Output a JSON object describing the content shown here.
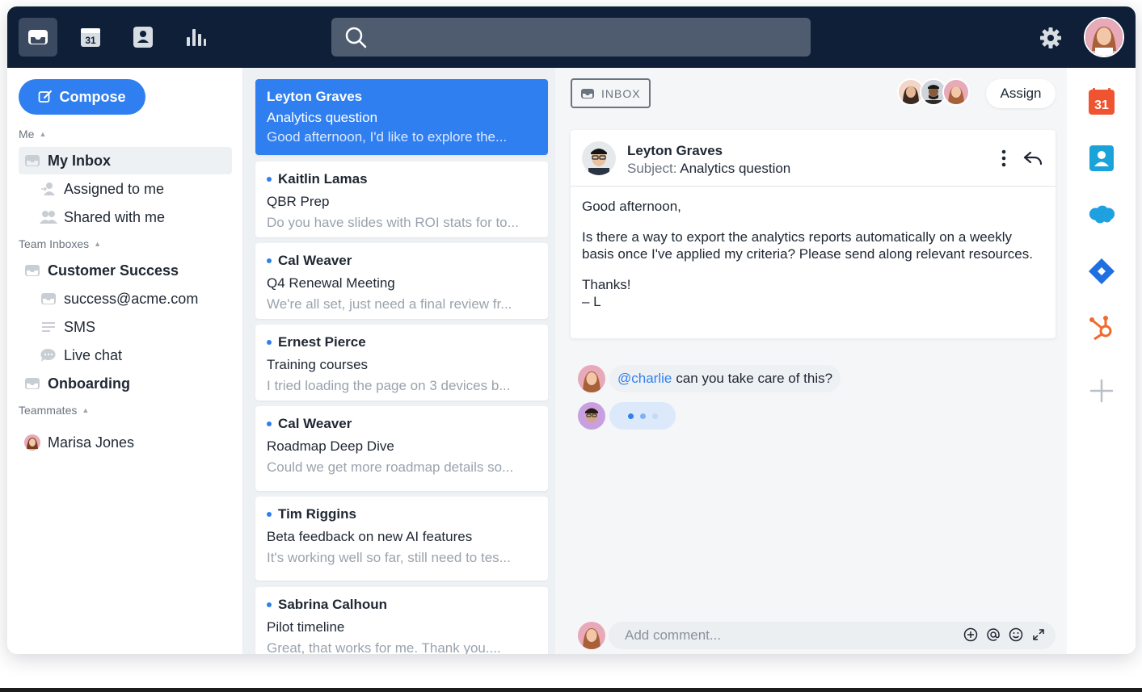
{
  "topbar": {
    "nav_icons": [
      "inbox-icon",
      "calendar-icon",
      "contacts-icon",
      "analytics-icon"
    ],
    "calendar_day": "31",
    "search_placeholder": ""
  },
  "sidebar": {
    "compose_label": "Compose",
    "me_section": "Me",
    "me_items": [
      {
        "label": "My Inbox",
        "icon": "inbox-icon"
      },
      {
        "label": "Assigned to me",
        "icon": "assigned-icon"
      },
      {
        "label": "Shared with me",
        "icon": "shared-icon"
      }
    ],
    "team_section": "Team Inboxes",
    "team_items": [
      {
        "label": "Customer Success",
        "icon": "inbox-icon"
      },
      {
        "label": "success@acme.com",
        "icon": "inbox-icon"
      },
      {
        "label": "SMS",
        "icon": "sms-icon"
      },
      {
        "label": "Live chat",
        "icon": "chat-icon"
      },
      {
        "label": "Onboarding",
        "icon": "inbox-icon"
      }
    ],
    "teammates_section": "Teammates",
    "teammates": [
      {
        "label": "Marisa Jones"
      }
    ]
  },
  "conversations": [
    {
      "name": "Leyton Graves",
      "subject": "Analytics question",
      "preview": "Good afternoon, I'd like to explore the..."
    },
    {
      "name": "Kaitlin Lamas",
      "subject": "QBR Prep",
      "preview": "Do you have slides with ROI stats for to..."
    },
    {
      "name": "Cal Weaver",
      "subject": "Q4 Renewal Meeting",
      "preview": "We're all set, just need a final review fr..."
    },
    {
      "name": "Ernest Pierce",
      "subject": "Training courses",
      "preview": "I tried loading the page on 3 devices b..."
    },
    {
      "name": "Cal Weaver",
      "subject": "Roadmap Deep Dive",
      "preview": "Could we get more roadmap details so..."
    },
    {
      "name": "Tim Riggins",
      "subject": "Beta feedback on new AI features",
      "preview": "It's working well so far, still need to tes..."
    },
    {
      "name": "Sabrina Calhoun",
      "subject": "Pilot timeline",
      "preview": "Great, that works for me. Thank you...."
    }
  ],
  "message": {
    "inbox_tag": "INBOX",
    "assign_label": "Assign",
    "from": "Leyton Graves",
    "subject_prefix": "Subject:",
    "subject": "Analytics question",
    "body": {
      "greeting": "Good afternoon,",
      "para1": "Is there a way to export the analytics reports automatically on a weekly basis once I've applied my criteria? Please send along relevant resources.",
      "thanks": "Thanks!",
      "sign": "– L"
    }
  },
  "comments": {
    "mention": "@charlie",
    "text": "can you take care of this?",
    "placeholder": "Add comment..."
  },
  "rail": {
    "calendar_day": "31",
    "icons": [
      "calendar-icon",
      "contact-card-icon",
      "salesforce-icon",
      "jira-icon",
      "hubspot-icon",
      "add-icon"
    ]
  },
  "colors": {
    "accent": "#2f7ff0",
    "topbar": "#0f1f38",
    "calendar_red": "#f0532f",
    "contact_teal": "#1aa3d9",
    "salesforce": "#1fa0e0",
    "jira": "#1f6fe0",
    "hubspot": "#f06a2f"
  }
}
